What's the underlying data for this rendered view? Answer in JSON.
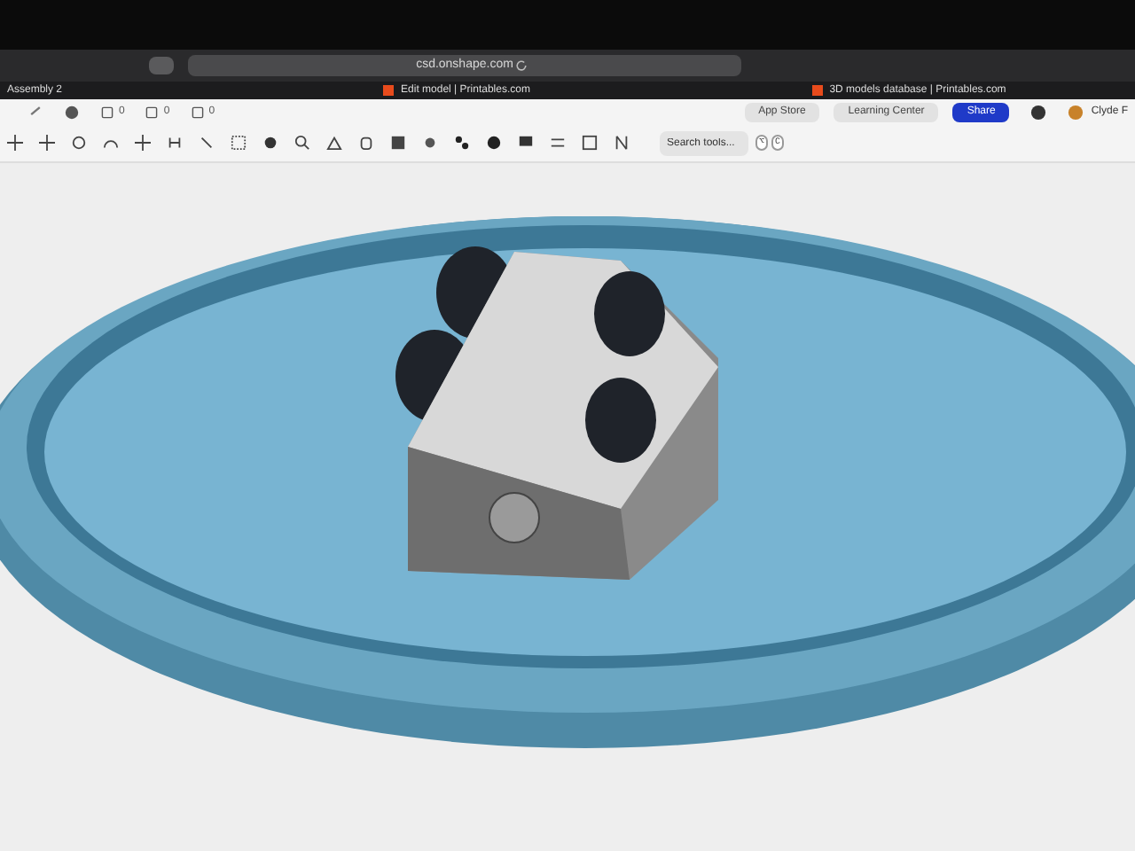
{
  "browser": {
    "address": "csd.onshape.com",
    "tabs": [
      {
        "title": "Edit model | Printables.com"
      },
      {
        "title": "3D models database | Printables.com"
      }
    ]
  },
  "document": {
    "title": "Assembly 2"
  },
  "toolbar": {
    "counts": [
      "0",
      "0",
      "0"
    ],
    "search": {
      "placeholder": "Search tools...",
      "keys": [
        "⌥",
        "C"
      ]
    }
  },
  "header_buttons": [
    {
      "label": "App Store",
      "kind": "plain"
    },
    {
      "label": "Learning Center",
      "kind": "plain"
    },
    {
      "label": "Share",
      "kind": "primary"
    }
  ],
  "user": {
    "name": "Clyde F"
  }
}
